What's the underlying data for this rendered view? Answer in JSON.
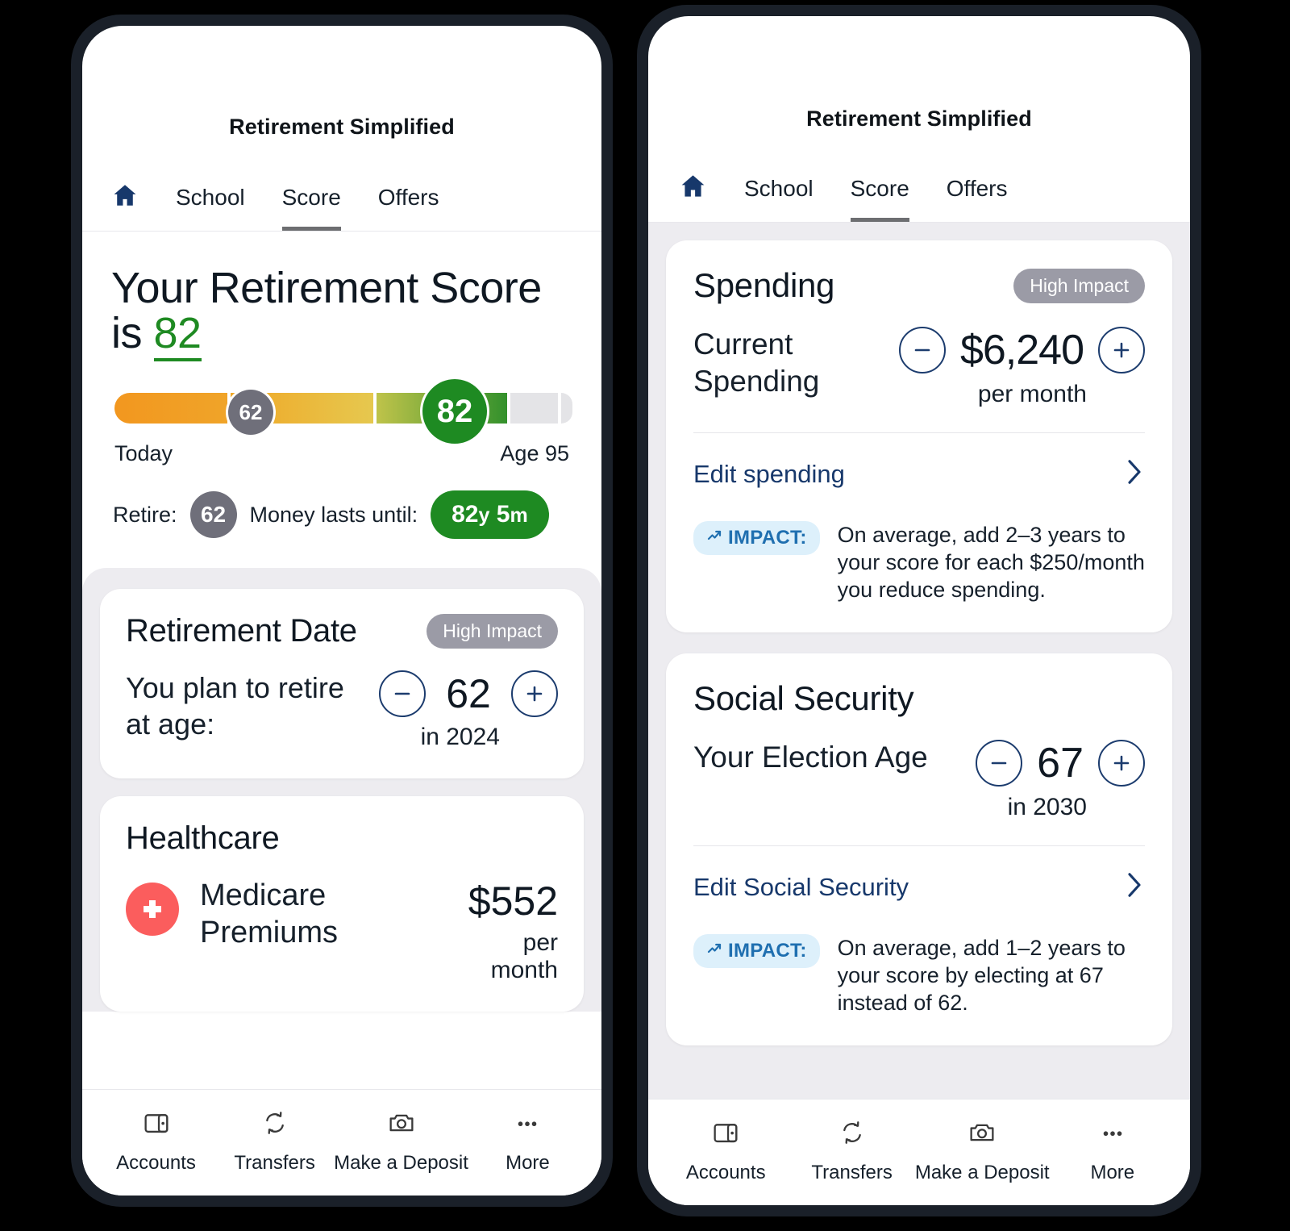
{
  "app": {
    "title": "Retirement Simplified",
    "tabs": [
      {
        "label": "School",
        "active": false
      },
      {
        "label": "Score",
        "active": true
      },
      {
        "label": "Offers",
        "active": false
      }
    ],
    "home_icon": "home-icon"
  },
  "hero": {
    "heading_prefix": "Your Retirement Score is ",
    "score": "82",
    "gauge": {
      "left_label": "Today",
      "right_label": "Age 95",
      "marker_retire": "62",
      "marker_score": "82"
    },
    "retire_label": "Retire:",
    "retire_age": "62",
    "money_label": "Money lasts until:",
    "money_years": "82",
    "money_years_unit": "y",
    "money_months": "5",
    "money_months_unit": "m"
  },
  "retirement_date_card": {
    "title": "Retirement Date",
    "badge": "High Impact",
    "label": "You plan to retire at age:",
    "value": "62",
    "sub": "in 2024",
    "minus_icon": "minus-icon",
    "plus_icon": "plus-icon"
  },
  "healthcare_card": {
    "title": "Healthcare",
    "item_icon": "medical-cross-icon",
    "item_name": "Medicare Premiums",
    "amount": "$552",
    "period": "per month"
  },
  "spending_card": {
    "title": "Spending",
    "badge": "High Impact",
    "label": "Current Spending",
    "value": "$6,240",
    "sub": "per month",
    "edit_label": "Edit spending",
    "chevron_icon": "chevron-right-icon",
    "impact_label": "IMPACT:",
    "impact_icon": "trending-up-icon",
    "impact_text": "On average, add 2–3 years to your score for each $250/month you reduce spending."
  },
  "social_security_card": {
    "title": "Social Security",
    "label": "Your Election Age",
    "value": "67",
    "sub": "in 2030",
    "edit_label": "Edit Social Security",
    "chevron_icon": "chevron-right-icon",
    "impact_label": "IMPACT:",
    "impact_icon": "trending-up-icon",
    "impact_text": "On average, add 1–2 years to your score by electing at 67 instead of 62."
  },
  "bottom_nav": [
    {
      "label": "Accounts",
      "icon": "wallet-icon"
    },
    {
      "label": "Transfers",
      "icon": "transfer-arrows-icon"
    },
    {
      "label": "Make a Deposit",
      "icon": "camera-icon"
    },
    {
      "label": "More",
      "icon": "ellipsis-icon"
    }
  ],
  "colors": {
    "brand_navy": "#17386b",
    "score_green": "#1e8a22",
    "badge_gray": "#9b9ba6",
    "impact_blue": "#1f6fb0",
    "impact_bg": "#ddf0fb",
    "medicare_red": "#fb5d5d",
    "panel_gray": "#edecf0",
    "frame_dark": "#1a2029"
  }
}
